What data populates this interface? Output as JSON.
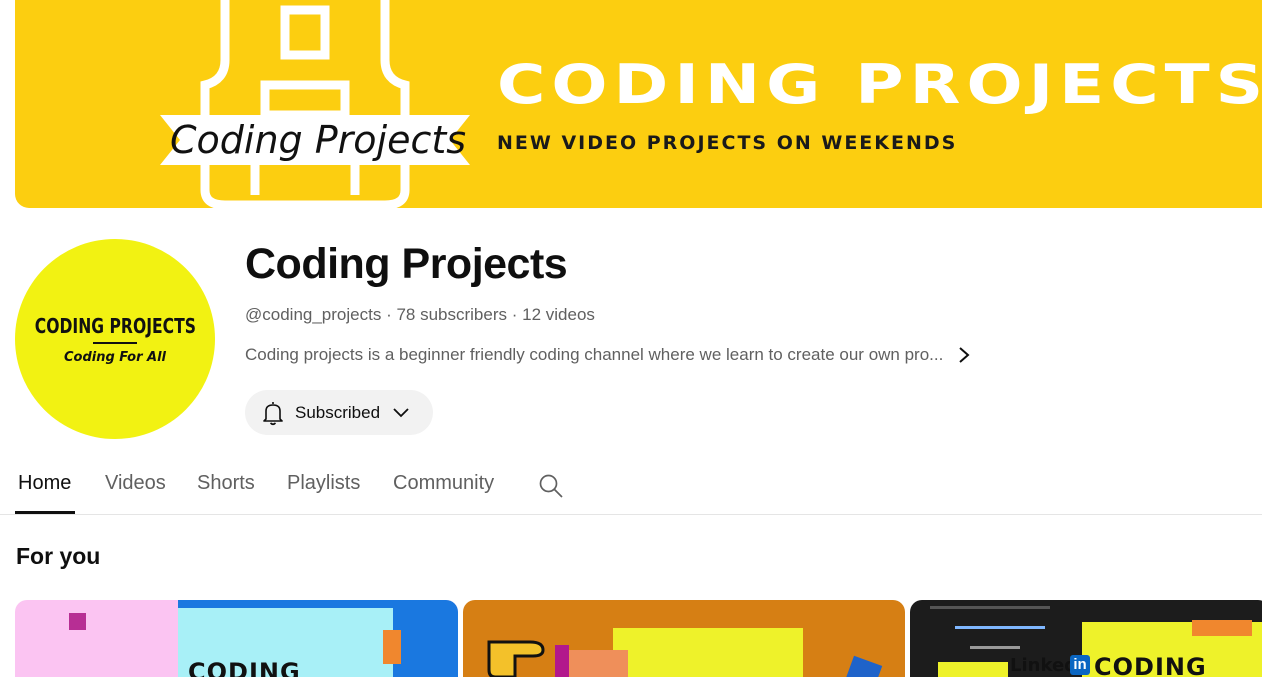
{
  "banner": {
    "title": "CODING PROJECTS",
    "tagline": "NEW VIDEO PROJECTS ON WEEKENDS",
    "logo_text": "Coding Projects"
  },
  "avatar": {
    "title": "CODING PROJECTS",
    "subtitle": "Coding For All"
  },
  "channel": {
    "name": "Coding Projects",
    "handle": "@coding_projects",
    "separator": " · ",
    "subscribers": "78 subscribers",
    "videos": "12 videos",
    "description": "Coding projects is a beginner friendly coding channel where we learn to create our own pro...",
    "subscribe_label": "Subscribed"
  },
  "tabs": [
    {
      "label": "Home",
      "active": true
    },
    {
      "label": "Videos",
      "active": false
    },
    {
      "label": "Shorts",
      "active": false
    },
    {
      "label": "Playlists",
      "active": false
    },
    {
      "label": "Community",
      "active": false
    }
  ],
  "section": {
    "title": "For you"
  },
  "thumbnails": [
    {
      "text": "CODING"
    },
    {
      "text": ""
    },
    {
      "brand": "Linked",
      "brand_badge": "in",
      "text": "CODING"
    }
  ],
  "colors": {
    "banner_bg": "#fcce10",
    "avatar_bg": "#f2f212",
    "text_primary": "#0f0f0f",
    "text_secondary": "#606060",
    "button_bg": "#f2f2f2"
  },
  "icons": [
    "bell-icon",
    "chevron-down-icon",
    "chevron-right-icon",
    "search-icon"
  ]
}
